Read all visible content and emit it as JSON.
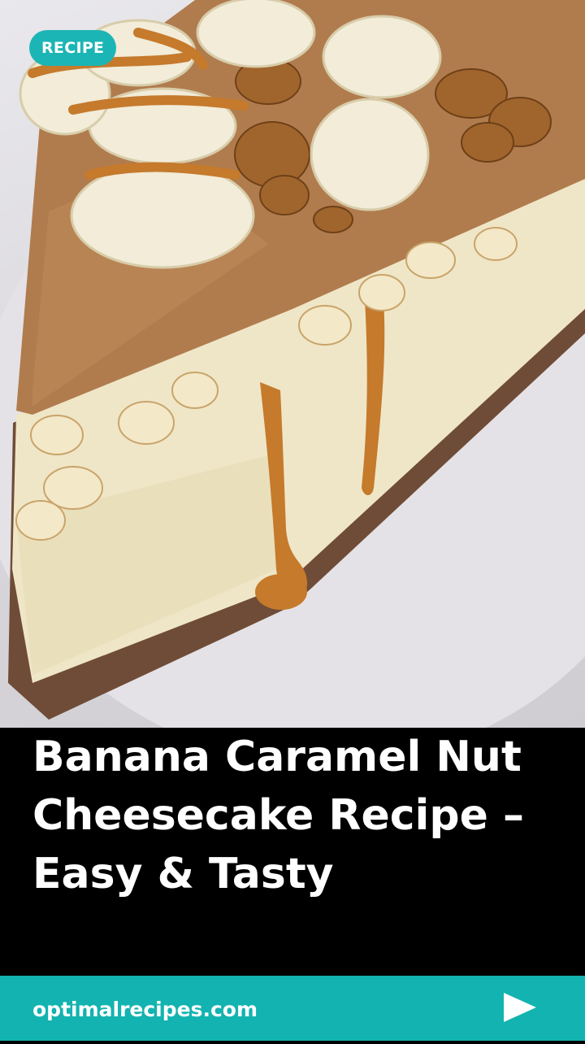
{
  "badge": {
    "label": "RECIPE"
  },
  "title": "Banana Caramel Nut Cheesecake Recipe – Easy & Tasty",
  "footer": {
    "site": "optimalrecipes.com",
    "icon": "play-arrow-icon"
  },
  "colors": {
    "accent": "#12b3b0",
    "caramel": "#c57a2c",
    "crust": "#6b4a37",
    "filling": "#efe6c6"
  }
}
